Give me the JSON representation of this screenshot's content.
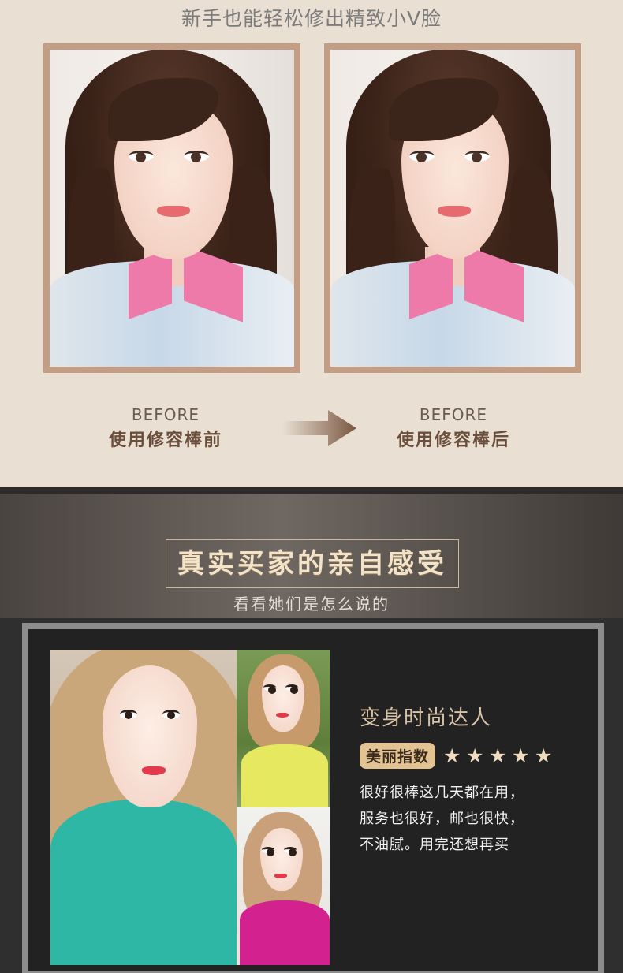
{
  "top": {
    "title": "新手也能轻松修出精致小V脸",
    "left": {
      "en": "BEFORE",
      "cn": "使用修容棒前"
    },
    "right": {
      "en": "BEFORE",
      "cn": "使用修容棒后"
    }
  },
  "section": {
    "title": "真实买家的亲自感受",
    "subtitle": "看看她们是怎么说的"
  },
  "review": {
    "reviewer": "变身时尚达人",
    "badge": "美丽指数",
    "rating": 5,
    "lines": [
      "很好很棒这几天都在用，",
      "服务也很好，邮也很快，",
      "不油腻。用完还想再买"
    ]
  },
  "colors": {
    "accent": "#c49d85",
    "badge": "#e3c391",
    "dark": "#222222"
  },
  "icons": [
    "arrow-right-icon",
    "star-icon"
  ]
}
